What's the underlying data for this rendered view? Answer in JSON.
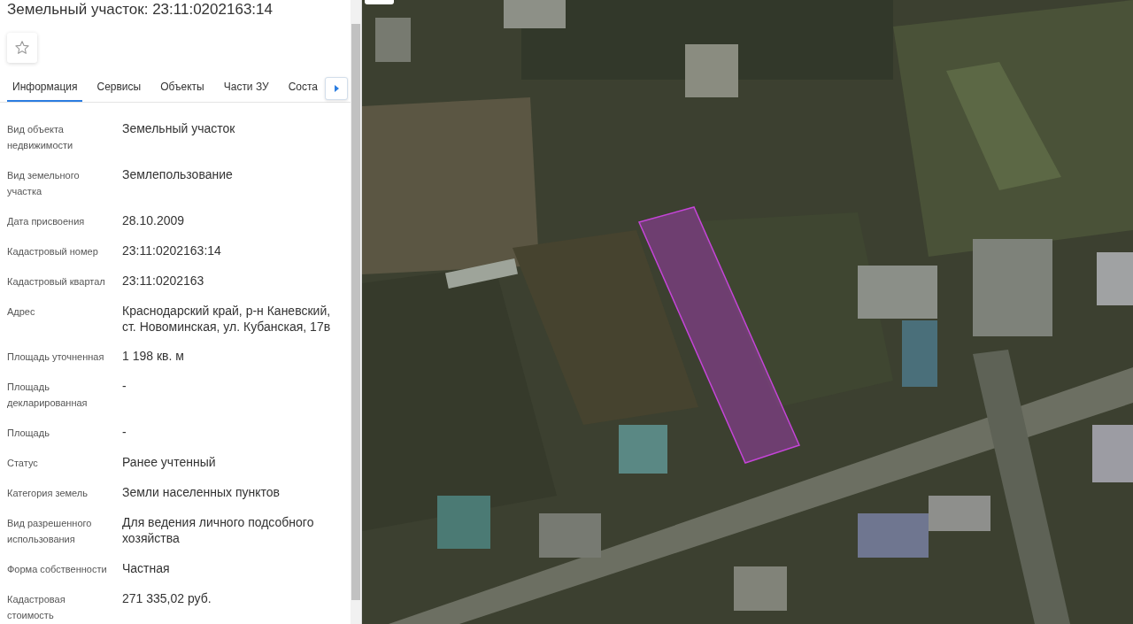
{
  "panel": {
    "title": "Земельный участок: 23:11:0202163:14",
    "favorite": false,
    "tabs": [
      {
        "label": "Информация",
        "selected": true
      },
      {
        "label": "Сервисы",
        "selected": false
      },
      {
        "label": "Объекты",
        "selected": false
      },
      {
        "label": "Части ЗУ",
        "selected": false
      },
      {
        "label": "Соста",
        "selected": false
      }
    ],
    "fields": [
      {
        "label": "Вид объекта недвижимости",
        "value": "Земельный участок"
      },
      {
        "label": "Вид земельного участка",
        "value": "Землепользование"
      },
      {
        "label": "Дата присвоения",
        "value": "28.10.2009"
      },
      {
        "label": "Кадастровый номер",
        "value": "23:11:0202163:14"
      },
      {
        "label": "Кадастровый квартал",
        "value": "23:11:0202163"
      },
      {
        "label": "Адрес",
        "value": "Краснодарский край, р-н Каневский, ст. Новоминская, ул. Кубанская, 17в"
      },
      {
        "label": "Площадь уточненная",
        "value": "1 198 кв. м"
      },
      {
        "label": "Площадь декларированная",
        "value": "-"
      },
      {
        "label": "Площадь",
        "value": "-"
      },
      {
        "label": "Статус",
        "value": "Ранее учтенный"
      },
      {
        "label": "Категория земель",
        "value": "Земли населенных пунктов"
      },
      {
        "label": "Вид разрешенного использования",
        "value": "Для ведения личного подсобного хозяйства"
      },
      {
        "label": "Форма собственности",
        "value": "Частная"
      },
      {
        "label": "Кадастровая стоимость",
        "value": "271 335,02 руб."
      }
    ]
  }
}
